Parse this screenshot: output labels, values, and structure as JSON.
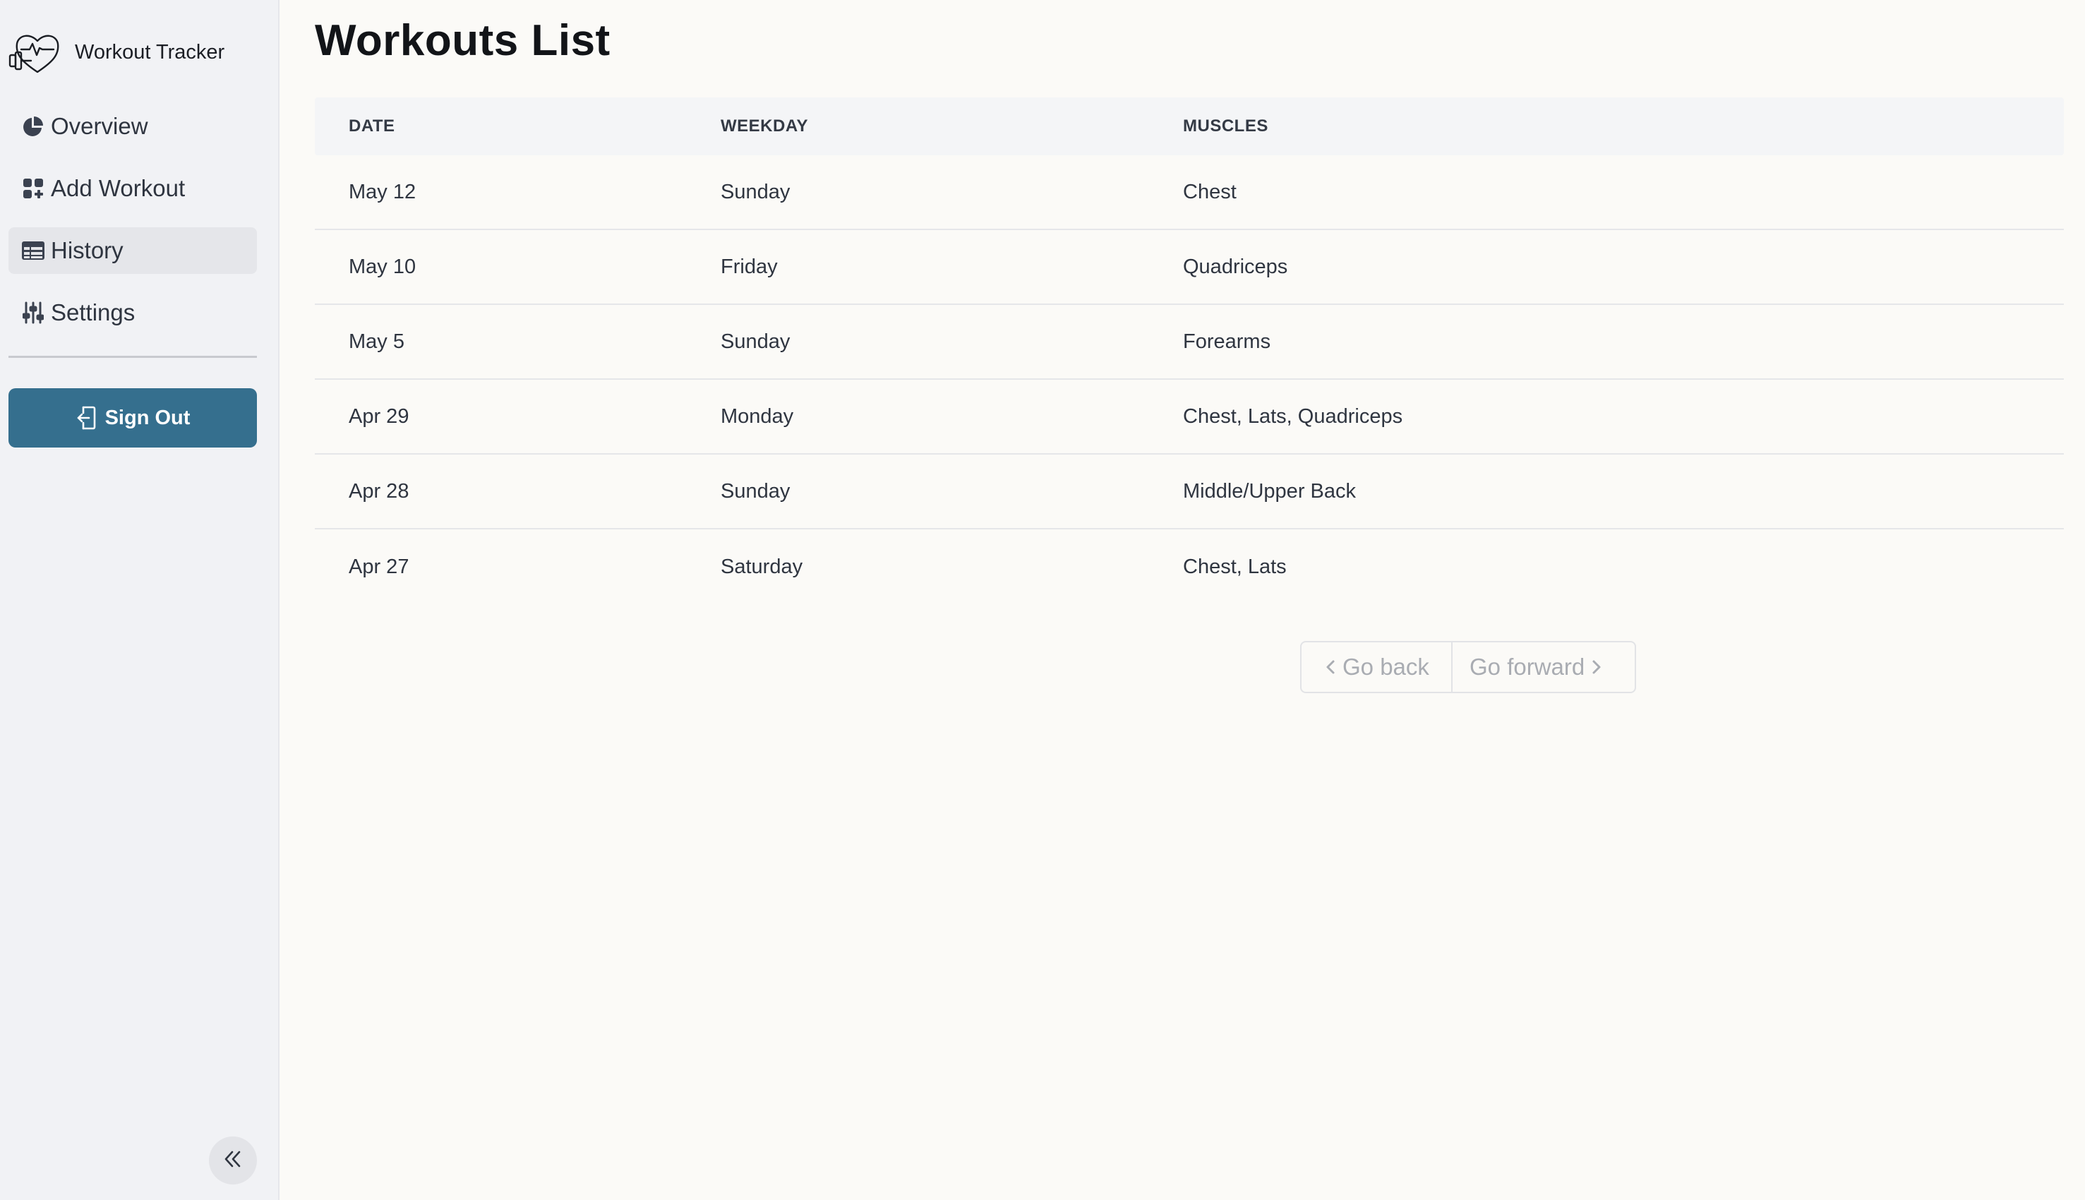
{
  "app": {
    "title": "Workout Tracker"
  },
  "sidebar": {
    "items": [
      {
        "label": "Overview",
        "icon": "pie-chart-icon",
        "active": false
      },
      {
        "label": "Add Workout",
        "icon": "add-grid-icon",
        "active": false
      },
      {
        "label": "History",
        "icon": "table-icon",
        "active": true
      },
      {
        "label": "Settings",
        "icon": "sliders-icon",
        "active": false
      }
    ],
    "signout_label": "Sign Out",
    "collapse_icon": "double-chevron-left-icon"
  },
  "main": {
    "title": "Workouts List",
    "table": {
      "headers": [
        "DATE",
        "WEEKDAY",
        "MUSCLES"
      ],
      "rows": [
        [
          "May 12",
          "Sunday",
          "Chest"
        ],
        [
          "May 10",
          "Friday",
          "Quadriceps"
        ],
        [
          "May 5",
          "Sunday",
          "Forearms"
        ],
        [
          "Apr 29",
          "Monday",
          "Chest, Lats, Quadriceps"
        ],
        [
          "Apr 28",
          "Sunday",
          "Middle/Upper Back"
        ],
        [
          "Apr 27",
          "Saturday",
          "Chest, Lats"
        ]
      ]
    },
    "pagination": {
      "back_label": "Go back",
      "forward_label": "Go forward"
    }
  },
  "colors": {
    "accent": "#356f8e",
    "sidebar_bg": "#f1f2f5",
    "page_bg": "#fbfaf7"
  }
}
